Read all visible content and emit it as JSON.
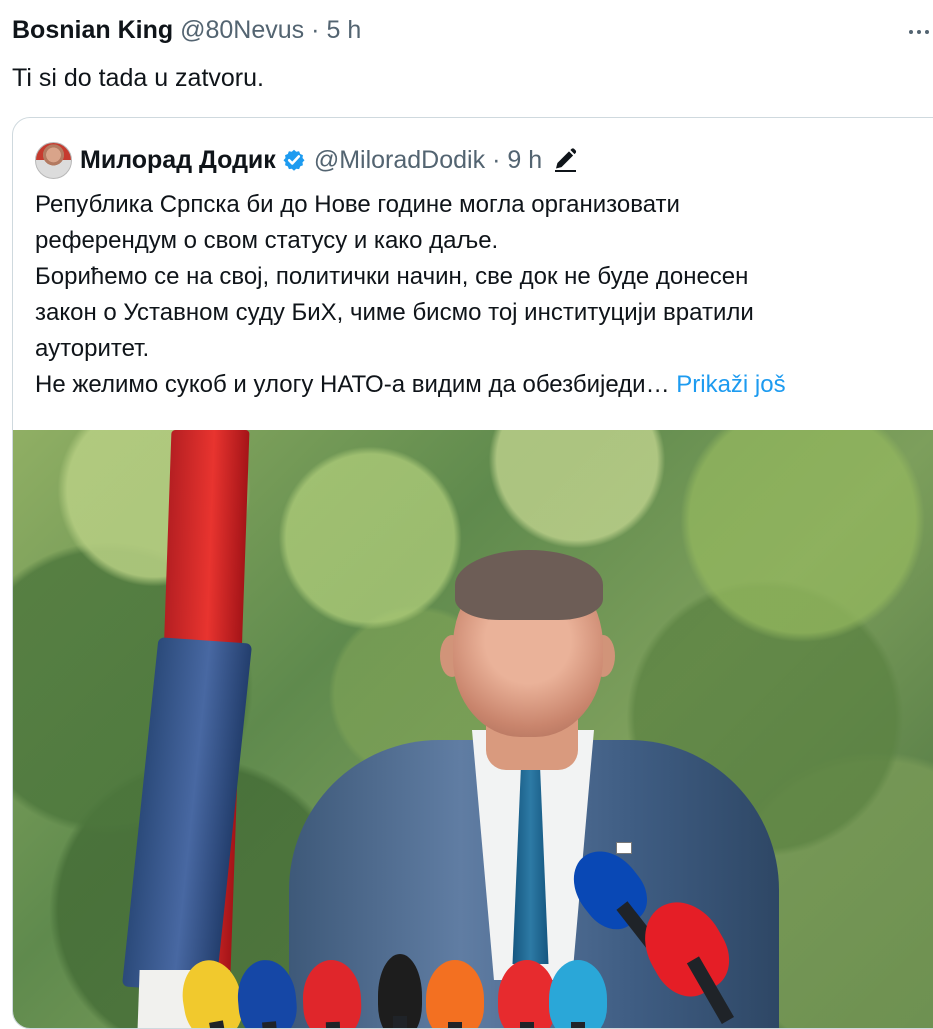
{
  "tweet": {
    "author_name": "Bosnian King",
    "author_handle": "@80Nevus",
    "separator": "·",
    "time": "5 h",
    "text": "Ti si do tada u zatvoru."
  },
  "quote": {
    "author_name": "Милорад Додик",
    "author_handle": "@MiloradDodik",
    "separator": "·",
    "time": "9 h",
    "text": "Република Српска би до Нове године могла организовати\nреферендум о свом статусу и како даље.\nБорићемо се на свој, политички начин, све док не буде донесен\nзакон о Уставном суду БиХ, чиме бисмо тој институцији вратили\nауторитет.\nНе желимо сукоб и улогу НАТО-а видим да обезбиједи…",
    "show_more": "Prikaži još"
  },
  "icons": {
    "more": "more-horizontal-icon",
    "verified": "verified-badge-icon",
    "edited": "edit-pencil-icon"
  },
  "colors": {
    "text": "#0f1419",
    "muted": "#536471",
    "link": "#1d9bf0",
    "verified": "#1d9bf0",
    "border": "#cfd9de"
  }
}
